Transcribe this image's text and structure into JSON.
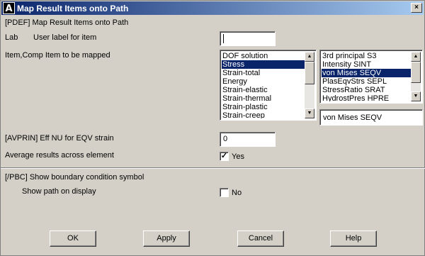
{
  "window": {
    "title": "Map Result Items onto Path",
    "logo": "A",
    "close_glyph": "×"
  },
  "header": {
    "command": "[PDEF]  Map Result Items onto Path"
  },
  "lab": {
    "label": "Lab",
    "description": "User label for item",
    "value": ""
  },
  "item_comp": {
    "label": "Item,Comp  Item to be mapped",
    "items": [
      "DOF solution",
      "Stress",
      "Strain-total",
      "Energy",
      "Strain-elastic",
      "Strain-thermal",
      "Strain-plastic",
      "Strain-creep"
    ],
    "selected_item": "Stress",
    "components": [
      "3rd principal S3",
      "Intensity  SINT",
      "von Mises  SEQV",
      "PlasEqvStrs SEPL",
      "StressRatio SRAT",
      "HydrostPres HPRE"
    ],
    "selected_component": "von Mises  SEQV",
    "selection_value": "von Mises   SEQV"
  },
  "avprin": {
    "label": "[AVPRIN]  Eff NU for EQV strain",
    "value": "0"
  },
  "average": {
    "label": "Average results across element",
    "checked": true,
    "check_glyph": "✓",
    "state_label": "Yes"
  },
  "pbc": {
    "label": "[/PBC]  Show boundary condition symbol"
  },
  "show_path": {
    "label": "Show path on display",
    "checked": false,
    "state_label": "No"
  },
  "buttons": {
    "ok": "OK",
    "apply": "Apply",
    "cancel": "Cancel",
    "help": "Help"
  },
  "scroll_glyphs": {
    "up": "▲",
    "down": "▼"
  },
  "colors": {
    "title_start": "#0a246a",
    "title_end": "#a6caf0",
    "selection": "#0a246a",
    "face": "#d4d0c8"
  }
}
